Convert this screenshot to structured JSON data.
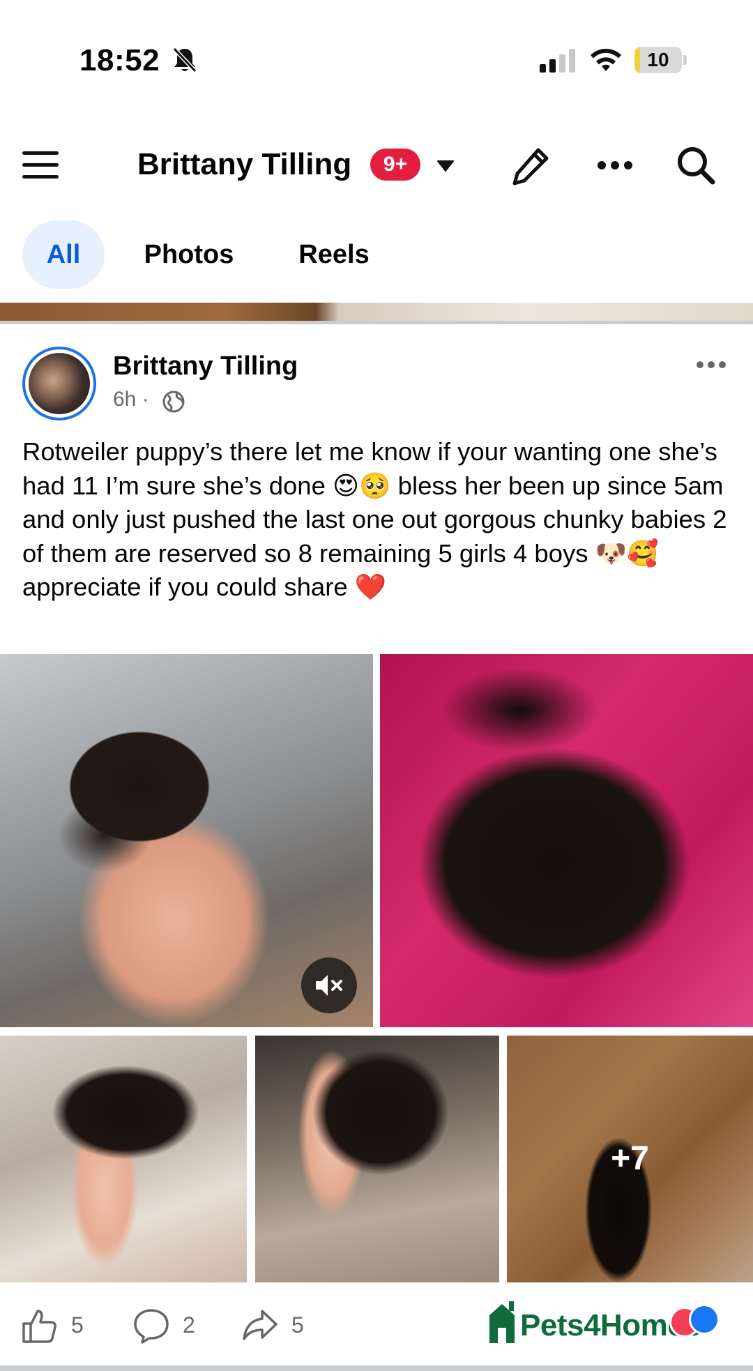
{
  "status_bar": {
    "time": "18:52",
    "battery_level": "10",
    "battery_fraction": 0.1,
    "icons": [
      "bell-slash-icon",
      "signal-icon",
      "wifi-icon",
      "battery-icon"
    ]
  },
  "header": {
    "profile_name": "Brittany Tilling",
    "notification_badge": "9+",
    "icons": [
      "menu-icon",
      "caret-down-icon",
      "edit-icon",
      "more-icon",
      "search-icon"
    ]
  },
  "filter_tabs": [
    {
      "label": "All",
      "active": true
    },
    {
      "label": "Photos",
      "active": false
    },
    {
      "label": "Reels",
      "active": false
    }
  ],
  "post": {
    "author": "Brittany Tilling",
    "time": "6h",
    "separator": "·",
    "audience_icon": "globe-icon",
    "text": "Rotweiler puppy’s there let me know if your wanting one she’s had 11 I’m sure she’s done 😍🥺 bless her been up since 5am and only just pushed the last one out gorgous chunky babies 2 of them are reserved so 8 remaining 5 girls 4 boys 🐶🥰 appreciate if you could share ❤️",
    "more_photos_label": "+7",
    "photo_count_visible": 5
  },
  "actions": {
    "likes": "5",
    "comments": "2",
    "shares": "5"
  },
  "sponsor": {
    "logo_text": "Pets4Homes",
    "brand_color": "#0e6b3a"
  },
  "colors": {
    "accent": "#1b74e4",
    "badge": "#e41e3f",
    "tab_active_bg": "#e7f0fd",
    "tab_active_text": "#0a5dd1"
  }
}
